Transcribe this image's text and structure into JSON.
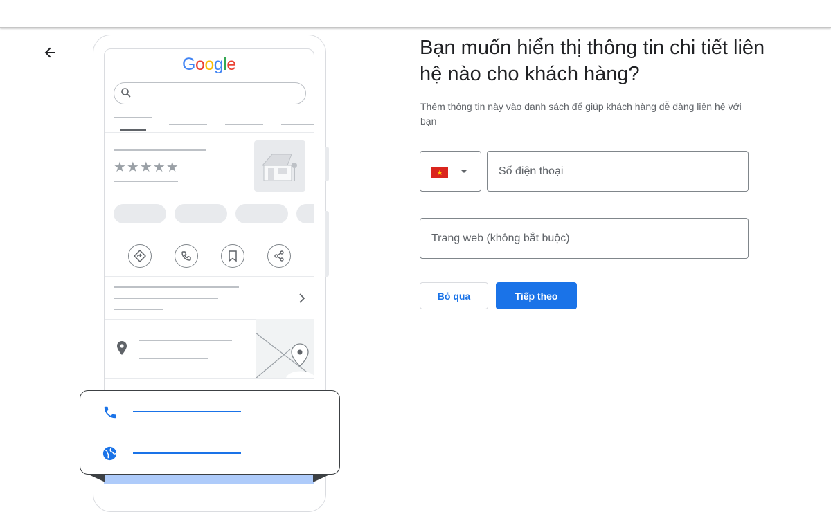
{
  "header": {
    "back_icon": "arrow-back-icon"
  },
  "illustration": {
    "logo_text": "Google",
    "logo_colors": [
      "#4285F4",
      "#EA4335",
      "#FBBC05",
      "#4285F4",
      "#34A853",
      "#EA4335"
    ],
    "rating_stars": "★★★★★",
    "action_icons": [
      "directions-icon",
      "phone-icon",
      "bookmark-icon",
      "share-icon"
    ],
    "card_rows": [
      "phone-icon",
      "globe-icon"
    ]
  },
  "form": {
    "title": "Bạn muốn hiển thị thông tin chi tiết liên hệ nào cho khách hàng?",
    "subtitle": "Thêm thông tin này vào danh sách để giúp khách hàng dễ dàng liên hệ với bạn",
    "country": {
      "flag": "vietnam-flag",
      "flag_color": "#da251d",
      "star_color": "#ffcd00"
    },
    "phone_placeholder": "Số điện thoại",
    "website_placeholder": "Trang web (không bắt buộc)",
    "skip_label": "Bỏ qua",
    "next_label": "Tiếp theo"
  },
  "colors": {
    "accent": "#1a73e8",
    "border": "#80868b",
    "muted_text": "#5f6368"
  }
}
